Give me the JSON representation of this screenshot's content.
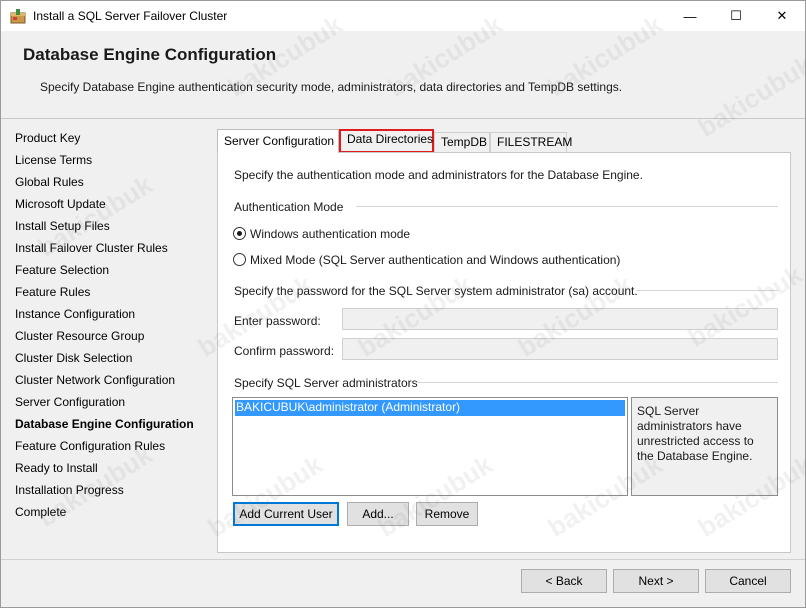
{
  "window": {
    "title": "Install a SQL Server Failover Cluster",
    "controls": {
      "minimize": "—",
      "maximize": "☐",
      "close": "✕"
    }
  },
  "header": {
    "title": "Database Engine Configuration",
    "description": "Specify Database Engine authentication security mode, administrators, data directories and TempDB settings."
  },
  "nav": {
    "items": [
      "Product Key",
      "License Terms",
      "Global Rules",
      "Microsoft Update",
      "Install Setup Files",
      "Install Failover Cluster Rules",
      "Feature Selection",
      "Feature Rules",
      "Instance Configuration",
      "Cluster Resource Group",
      "Cluster Disk Selection",
      "Cluster Network Configuration",
      "Server Configuration",
      "Database Engine Configuration",
      "Feature Configuration Rules",
      "Ready to Install",
      "Installation Progress",
      "Complete"
    ],
    "active": "Database Engine Configuration"
  },
  "tabs": {
    "server_config": "Server Configuration",
    "data_directories": "Data Directories",
    "tempdb": "TempDB",
    "filestream": "FILESTREAM"
  },
  "panel": {
    "intro": "Specify the authentication mode and administrators for the Database Engine.",
    "auth_mode_label": "Authentication Mode",
    "windows_auth": "Windows authentication mode",
    "mixed_mode": "Mixed Mode (SQL Server authentication and Windows authentication)",
    "password_section": "Specify the password for the SQL Server system administrator (sa) account.",
    "enter_password": "Enter password:",
    "confirm_password": "Confirm password:",
    "admins_label": "Specify SQL Server administrators",
    "admins": [
      "BAKICUBUK\\administrator (Administrator)"
    ],
    "admins_info": "SQL Server administrators have unrestricted access to the Database Engine.",
    "add_current_user": "Add Current User",
    "add": "Add...",
    "remove": "Remove"
  },
  "footer": {
    "back": "< Back",
    "next": "Next >",
    "cancel": "Cancel"
  },
  "watermark": "bakicubuk",
  "colors": {
    "highlight": "#e01b1b",
    "selection": "#3399ff",
    "default_button": "#0078d7"
  }
}
